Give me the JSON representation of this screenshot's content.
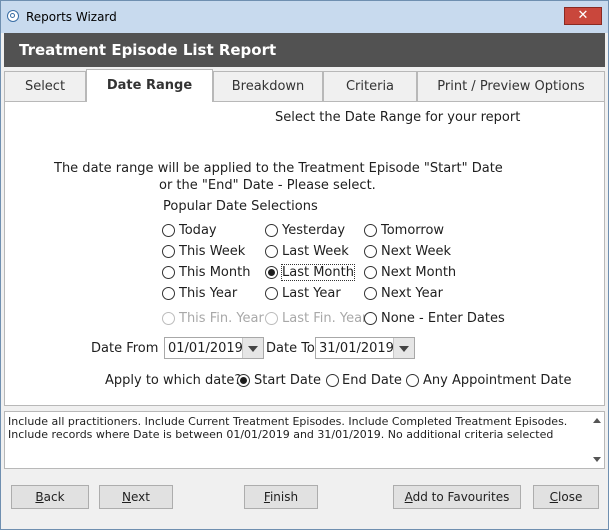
{
  "window": {
    "title": "Reports Wizard",
    "close_glyph": "✕"
  },
  "header": {
    "title": "Treatment Episode List Report"
  },
  "tabs": [
    {
      "label": "Select"
    },
    {
      "label": "Date Range"
    },
    {
      "label": "Breakdown"
    },
    {
      "label": "Criteria"
    },
    {
      "label": "Print / Preview Options"
    }
  ],
  "panel": {
    "heading": "Select the Date Range for your report",
    "info_line1": "The date range will be applied to the Treatment Episode \"Start\" Date",
    "info_line2": "or the \"End\" Date - Please select.",
    "popular_label": "Popular Date Selections",
    "radios": {
      "today": "Today",
      "yesterday": "Yesterday",
      "tomorrow": "Tomorrow",
      "this_week": "This Week",
      "last_week": "Last Week",
      "next_week": "Next Week",
      "this_month": "This Month",
      "last_month": "Last Month",
      "next_month": "Next Month",
      "this_year": "This Year",
      "last_year": "Last Year",
      "next_year": "Next Year",
      "this_fin_year": "This Fin. Year",
      "last_fin_year": "Last Fin. Year",
      "none_enter": "None - Enter Dates"
    },
    "date_from_label": "Date From",
    "date_from_value": "01/01/2019",
    "date_to_label": "Date To",
    "date_to_value": "31/01/2019",
    "apply_label": "Apply to which date?",
    "apply_options": {
      "start": "Start Date",
      "end": "End Date",
      "any": "Any Appointment Date"
    }
  },
  "summary": {
    "text": "Include all practitioners. Include Current Treatment Episodes. Include Completed Treatment Episodes. Include records where Date is between 01/01/2019 and 31/01/2019. No additional criteria selected"
  },
  "buttons": {
    "back_u": "B",
    "back_rest": "ack",
    "next_u": "N",
    "next_rest": "ext",
    "finish_u": "F",
    "finish_rest": "inish",
    "fav_u": "A",
    "fav_rest": "dd to Favourites",
    "close_u": "C",
    "close_rest": "lose"
  }
}
